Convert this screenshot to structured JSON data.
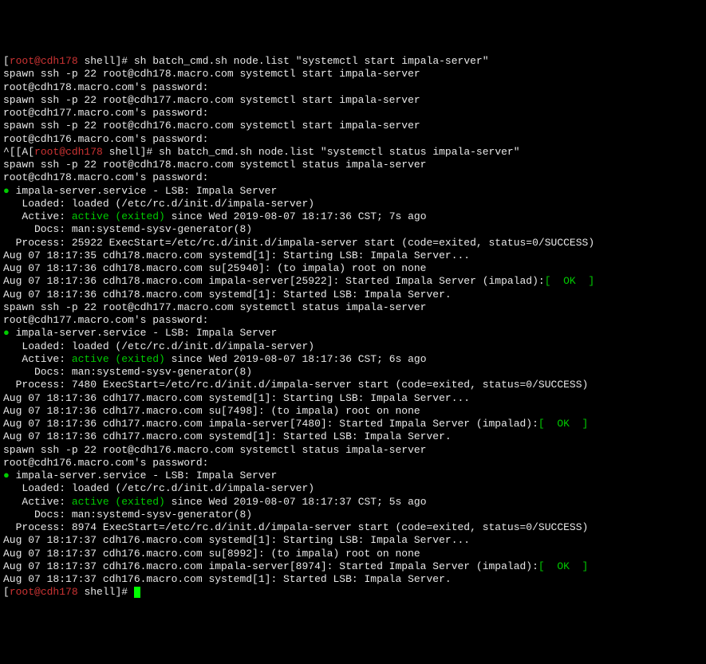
{
  "lines": [
    {
      "segments": [
        {
          "t": "[",
          "c": "white"
        },
        {
          "t": "root@cdh178",
          "c": "red"
        },
        {
          "t": " shell",
          "c": "white"
        },
        {
          "t": "]# sh batch_cmd.sh node.list \"systemctl start impala-server\"",
          "c": "white"
        }
      ]
    },
    {
      "segments": [
        {
          "t": "spawn ssh -p 22 root@cdh178.macro.com systemctl start impala-server",
          "c": "white"
        }
      ]
    },
    {
      "segments": [
        {
          "t": "root@cdh178.macro.com's password:",
          "c": "white"
        }
      ]
    },
    {
      "segments": [
        {
          "t": "spawn ssh -p 22 root@cdh177.macro.com systemctl start impala-server",
          "c": "white"
        }
      ]
    },
    {
      "segments": [
        {
          "t": "root@cdh177.macro.com's password:",
          "c": "white"
        }
      ]
    },
    {
      "segments": [
        {
          "t": "spawn ssh -p 22 root@cdh176.macro.com systemctl start impala-server",
          "c": "white"
        }
      ]
    },
    {
      "segments": [
        {
          "t": "root@cdh176.macro.com's password:",
          "c": "white"
        }
      ]
    },
    {
      "segments": [
        {
          "t": "^[[A[",
          "c": "white"
        },
        {
          "t": "root@cdh178",
          "c": "red"
        },
        {
          "t": " shell",
          "c": "white"
        },
        {
          "t": "]# sh batch_cmd.sh node.list \"systemctl status impala-server\"",
          "c": "white"
        }
      ]
    },
    {
      "segments": [
        {
          "t": "spawn ssh -p 22 root@cdh178.macro.com systemctl status impala-server",
          "c": "white"
        }
      ]
    },
    {
      "segments": [
        {
          "t": "root@cdh178.macro.com's password:",
          "c": "white"
        }
      ]
    },
    {
      "segments": [
        {
          "t": "●",
          "c": "green"
        },
        {
          "t": " impala-server.service - LSB: Impala Server",
          "c": "white"
        }
      ]
    },
    {
      "segments": [
        {
          "t": "   Loaded: loaded (/etc/rc.d/init.d/impala-server)",
          "c": "white"
        }
      ]
    },
    {
      "segments": [
        {
          "t": "   Active: ",
          "c": "white"
        },
        {
          "t": "active (exited)",
          "c": "green"
        },
        {
          "t": " since Wed 2019-08-07 18:17:36 CST; 7s ago",
          "c": "white"
        }
      ]
    },
    {
      "segments": [
        {
          "t": "     Docs: man:systemd-sysv-generator(8)",
          "c": "white"
        }
      ]
    },
    {
      "segments": [
        {
          "t": "  Process: 25922 ExecStart=/etc/rc.d/init.d/impala-server start (code=exited, status=0/SUCCESS)",
          "c": "white"
        }
      ]
    },
    {
      "segments": [
        {
          "t": "",
          "c": "white"
        }
      ]
    },
    {
      "segments": [
        {
          "t": "Aug 07 18:17:35 cdh178.macro.com systemd[1]: Starting LSB: Impala Server...",
          "c": "white"
        }
      ]
    },
    {
      "segments": [
        {
          "t": "Aug 07 18:17:36 cdh178.macro.com su[25940]: (to impala) root on none",
          "c": "white"
        }
      ]
    },
    {
      "segments": [
        {
          "t": "Aug 07 18:17:36 cdh178.macro.com impala-server[25922]: Started Impala Server (impalad):",
          "c": "white"
        },
        {
          "t": "[  OK  ]",
          "c": "green"
        }
      ]
    },
    {
      "segments": [
        {
          "t": "Aug 07 18:17:36 cdh178.macro.com systemd[1]: Started LSB: Impala Server.",
          "c": "white"
        }
      ]
    },
    {
      "segments": [
        {
          "t": "spawn ssh -p 22 root@cdh177.macro.com systemctl status impala-server",
          "c": "white"
        }
      ]
    },
    {
      "segments": [
        {
          "t": "root@cdh177.macro.com's password:",
          "c": "white"
        }
      ]
    },
    {
      "segments": [
        {
          "t": "●",
          "c": "green"
        },
        {
          "t": " impala-server.service - LSB: Impala Server",
          "c": "white"
        }
      ]
    },
    {
      "segments": [
        {
          "t": "   Loaded: loaded (/etc/rc.d/init.d/impala-server)",
          "c": "white"
        }
      ]
    },
    {
      "segments": [
        {
          "t": "   Active: ",
          "c": "white"
        },
        {
          "t": "active (exited)",
          "c": "green"
        },
        {
          "t": " since Wed 2019-08-07 18:17:36 CST; 6s ago",
          "c": "white"
        }
      ]
    },
    {
      "segments": [
        {
          "t": "     Docs: man:systemd-sysv-generator(8)",
          "c": "white"
        }
      ]
    },
    {
      "segments": [
        {
          "t": "  Process: 7480 ExecStart=/etc/rc.d/init.d/impala-server start (code=exited, status=0/SUCCESS)",
          "c": "white"
        }
      ]
    },
    {
      "segments": [
        {
          "t": "",
          "c": "white"
        }
      ]
    },
    {
      "segments": [
        {
          "t": "Aug 07 18:17:36 cdh177.macro.com systemd[1]: Starting LSB: Impala Server...",
          "c": "white"
        }
      ]
    },
    {
      "segments": [
        {
          "t": "Aug 07 18:17:36 cdh177.macro.com su[7498]: (to impala) root on none",
          "c": "white"
        }
      ]
    },
    {
      "segments": [
        {
          "t": "Aug 07 18:17:36 cdh177.macro.com impala-server[7480]: Started Impala Server (impalad):",
          "c": "white"
        },
        {
          "t": "[  OK  ]",
          "c": "green"
        }
      ]
    },
    {
      "segments": [
        {
          "t": "Aug 07 18:17:36 cdh177.macro.com systemd[1]: Started LSB: Impala Server.",
          "c": "white"
        }
      ]
    },
    {
      "segments": [
        {
          "t": "spawn ssh -p 22 root@cdh176.macro.com systemctl status impala-server",
          "c": "white"
        }
      ]
    },
    {
      "segments": [
        {
          "t": "root@cdh176.macro.com's password:",
          "c": "white"
        }
      ]
    },
    {
      "segments": [
        {
          "t": "●",
          "c": "green"
        },
        {
          "t": " impala-server.service - LSB: Impala Server",
          "c": "white"
        }
      ]
    },
    {
      "segments": [
        {
          "t": "   Loaded: loaded (/etc/rc.d/init.d/impala-server)",
          "c": "white"
        }
      ]
    },
    {
      "segments": [
        {
          "t": "   Active: ",
          "c": "white"
        },
        {
          "t": "active (exited)",
          "c": "green"
        },
        {
          "t": " since Wed 2019-08-07 18:17:37 CST; 5s ago",
          "c": "white"
        }
      ]
    },
    {
      "segments": [
        {
          "t": "     Docs: man:systemd-sysv-generator(8)",
          "c": "white"
        }
      ]
    },
    {
      "segments": [
        {
          "t": "  Process: 8974 ExecStart=/etc/rc.d/init.d/impala-server start (code=exited, status=0/SUCCESS)",
          "c": "white"
        }
      ]
    },
    {
      "segments": [
        {
          "t": "",
          "c": "white"
        }
      ]
    },
    {
      "segments": [
        {
          "t": "Aug 07 18:17:37 cdh176.macro.com systemd[1]: Starting LSB: Impala Server...",
          "c": "white"
        }
      ]
    },
    {
      "segments": [
        {
          "t": "Aug 07 18:17:37 cdh176.macro.com su[8992]: (to impala) root on none",
          "c": "white"
        }
      ]
    },
    {
      "segments": [
        {
          "t": "Aug 07 18:17:37 cdh176.macro.com impala-server[8974]: Started Impala Server (impalad):",
          "c": "white"
        },
        {
          "t": "[  OK  ]",
          "c": "green"
        }
      ]
    },
    {
      "segments": [
        {
          "t": "Aug 07 18:17:37 cdh176.macro.com systemd[1]: Started LSB: Impala Server.",
          "c": "white"
        }
      ]
    },
    {
      "segments": [
        {
          "t": "[",
          "c": "white"
        },
        {
          "t": "root@cdh178",
          "c": "red"
        },
        {
          "t": " shell",
          "c": "white"
        },
        {
          "t": "]# ",
          "c": "white"
        }
      ],
      "cursor": true
    }
  ]
}
